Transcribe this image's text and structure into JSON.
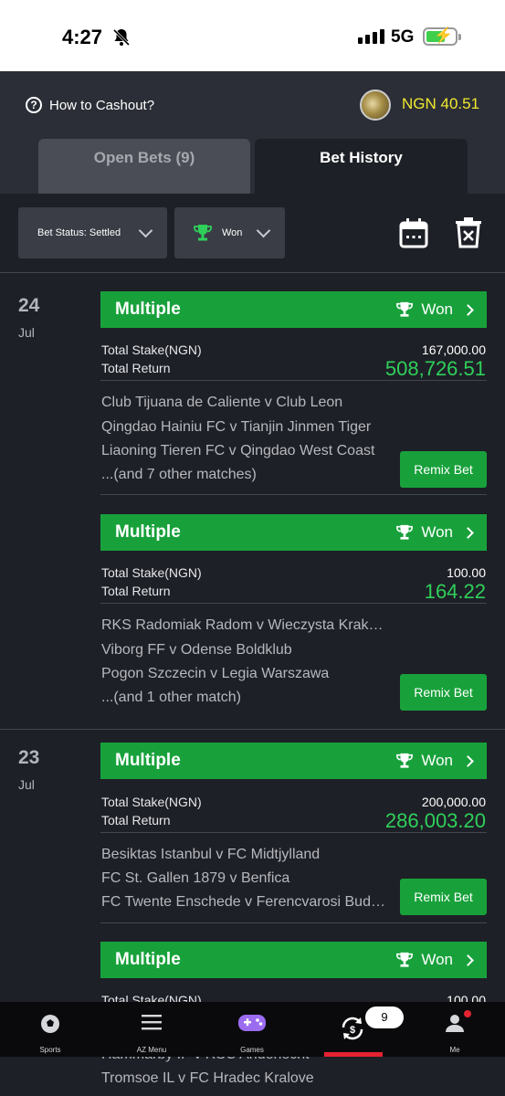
{
  "status_bar": {
    "time": "4:27",
    "network": "5G"
  },
  "header": {
    "cashout_label": "How to Cashout?",
    "balance": "NGN 40.51"
  },
  "tabs": [
    {
      "label": "Open Bets (9)",
      "active": false
    },
    {
      "label": "Bet History",
      "active": true
    }
  ],
  "filters": {
    "status": "Bet Status: Settled",
    "result": "Won"
  },
  "days": [
    {
      "day": "24",
      "month": "Jul"
    },
    {
      "day": "23",
      "month": "Jul"
    }
  ],
  "labels": {
    "total_stake": "Total Stake(NGN)",
    "total_return": "Total Return",
    "remix": "Remix Bet"
  },
  "bets": [
    {
      "type": "Multiple",
      "result": "Won",
      "stake": "167,000.00",
      "return": "508,726.51",
      "matches": [
        "Club Tijuana de Caliente v Club Leon",
        "Qingdao Hainiu FC v Tianjin Jinmen Tiger",
        "Liaoning Tieren FC v Qingdao West Coast",
        "...(and 7 other matches)"
      ]
    },
    {
      "type": "Multiple",
      "result": "Won",
      "stake": "100.00",
      "return": "164.22",
      "matches": [
        "RKS Radomiak Radom v Wieczysta Krakow",
        "Viborg FF v Odense Boldklub",
        "Pogon Szczecin v Legia Warszawa",
        "...(and 1 other match)"
      ]
    },
    {
      "type": "Multiple",
      "result": "Won",
      "stake": "200,000.00",
      "return": "286,003.20",
      "matches": [
        "Besiktas Istanbul v FC Midtjylland",
        "FC St. Gallen 1879 v Benfica",
        "FC Twente Enschede v Ferencvarosi Budapest"
      ]
    },
    {
      "type": "Multiple",
      "result": "Won",
      "stake": "100.00",
      "matches_partial": [
        "Hammarby IF v RSC Anderlecht",
        "Tromsoe IL v FC Hradec Kralove"
      ]
    }
  ],
  "bottom_nav": {
    "items": [
      {
        "label": "Sports",
        "icon": "soccer-ball-icon"
      },
      {
        "label": "AZ Menu",
        "icon": "menu-icon"
      },
      {
        "label": "Games",
        "icon": "gamepad-icon"
      },
      {
        "label": "",
        "icon": "cashout-icon"
      },
      {
        "label": "Me",
        "icon": "user-icon"
      }
    ],
    "badge": "9"
  },
  "colors": {
    "accent_green": "#18a13b",
    "return_green": "#2fd05a",
    "balance_yellow": "#f2e830",
    "active_red": "#e52330"
  }
}
